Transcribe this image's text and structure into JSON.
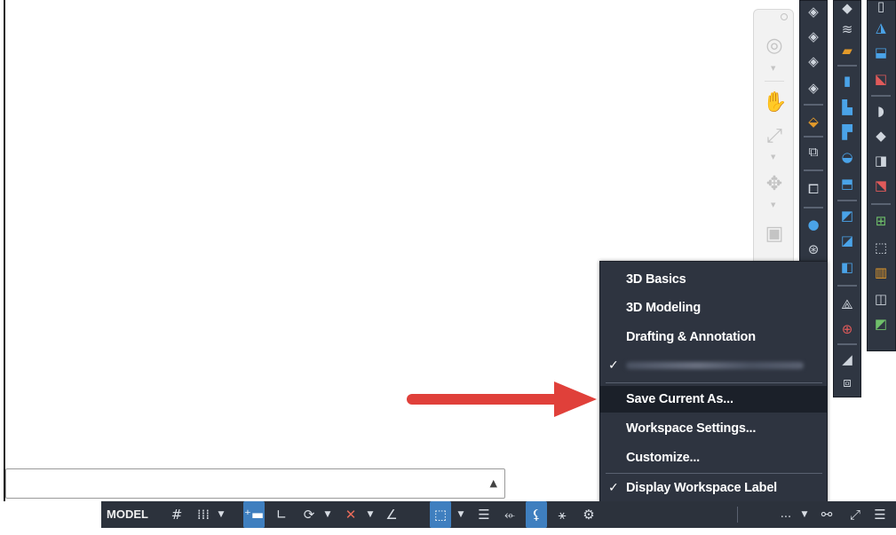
{
  "workspace_menu": {
    "items": [
      {
        "label": "3D Basics"
      },
      {
        "label": "3D Modeling"
      },
      {
        "label": "Drafting & Annotation"
      },
      {
        "label": ""
      },
      {
        "label": "Save Current As..."
      },
      {
        "label": "Workspace Settings..."
      },
      {
        "label": "Customize..."
      },
      {
        "label": "Display Workspace Label"
      }
    ],
    "checked": [
      3,
      7
    ],
    "highlighted_index": 4
  },
  "status_bar": {
    "model_label": "MODEL",
    "more_label": "...",
    "icons": [
      "grid-icon",
      "snap-icon",
      "dynamic-input-icon",
      "ortho-icon",
      "polar-icon",
      "isodraft-icon",
      "object-snap-tracking-icon",
      "object-snap-icon",
      "lineweight-icon",
      "transparency-icon",
      "selection-cycling-icon",
      "annotation-monitor-icon",
      "workspace-gear-icon",
      "customize-icon",
      "fullscreen-icon",
      "menu-icon"
    ]
  },
  "command_line": {
    "value": ""
  },
  "colors": {
    "menu_bg": "#2e3440",
    "menu_highlight": "#1b2029",
    "status_bg": "#2c323c",
    "arrow": "#e0403a",
    "active_toggle": "#3f7fbf"
  }
}
